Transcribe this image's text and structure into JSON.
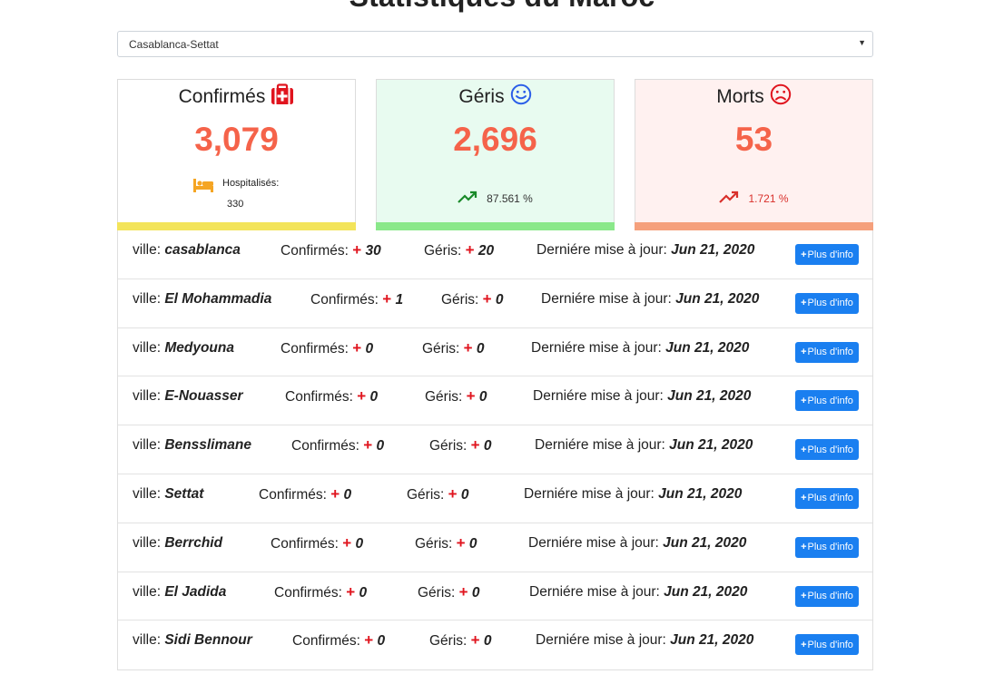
{
  "page": {
    "title": "Statistiques du Maroc"
  },
  "region_select": {
    "value": "Casablanca-Settat"
  },
  "cards": {
    "confirmed": {
      "title": "Confirmés",
      "value": "3,079",
      "hosp_label": "Hospitalisés:",
      "hosp_value": "330"
    },
    "recovered": {
      "title": "Géris",
      "value": "2,696",
      "percent": "87.561 %"
    },
    "deaths": {
      "title": "Morts",
      "value": "53",
      "percent": "1.721 %"
    }
  },
  "labels": {
    "ville": "ville:",
    "confirmes": "Confirmés:",
    "geris": "Géris:",
    "maj": "Derniére mise à jour:",
    "plus": "+",
    "button": "Plus d'info"
  },
  "cities": [
    {
      "name": "casablanca",
      "confirmed": "30",
      "recovered": "20",
      "date": "Jun 21, 2020"
    },
    {
      "name": "El Mohammadia",
      "confirmed": "1",
      "recovered": "0",
      "date": "Jun 21, 2020"
    },
    {
      "name": "Medyouna",
      "confirmed": "0",
      "recovered": "0",
      "date": "Jun 21, 2020"
    },
    {
      "name": "E-Nouasser",
      "confirmed": "0",
      "recovered": "0",
      "date": "Jun 21, 2020"
    },
    {
      "name": "Bensslimane",
      "confirmed": "0",
      "recovered": "0",
      "date": "Jun 21, 2020"
    },
    {
      "name": "Settat",
      "confirmed": "0",
      "recovered": "0",
      "date": "Jun 21, 2020"
    },
    {
      "name": "Berrchid",
      "confirmed": "0",
      "recovered": "0",
      "date": "Jun 21, 2020"
    },
    {
      "name": "El Jadida",
      "confirmed": "0",
      "recovered": "0",
      "date": "Jun 21, 2020"
    },
    {
      "name": "Sidi Bennour",
      "confirmed": "0",
      "recovered": "0",
      "date": "Jun 21, 2020"
    }
  ],
  "icons": {
    "medkit": "medkit-icon",
    "smile": "smile-icon",
    "frown": "frown-icon",
    "bed": "bed-icon",
    "trend_up": "trend-up-icon",
    "plus": "plus-icon"
  },
  "colors": {
    "number": "#f5634a",
    "confirmed_bar": "#f3e45a",
    "recovered_bar": "#8ae88a",
    "deaths_bar": "#f5a07c",
    "button": "#1a7ff0",
    "plus": "#e0141e"
  }
}
